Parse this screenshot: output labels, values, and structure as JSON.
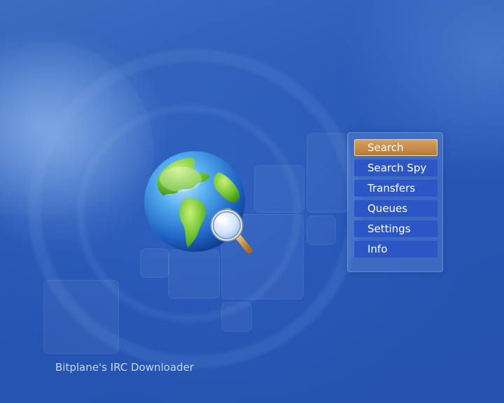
{
  "app": {
    "title": "Bitplane's IRC Downloader"
  },
  "logo": {
    "icon": "globe-magnifier-icon"
  },
  "menu": {
    "selected_index": 0,
    "items": [
      {
        "label": "Search"
      },
      {
        "label": "Search Spy"
      },
      {
        "label": "Transfers"
      },
      {
        "label": "Queues"
      },
      {
        "label": "Settings"
      },
      {
        "label": "Info"
      }
    ]
  },
  "colors": {
    "background": "#3366c4",
    "menu_item": "#2c56c6",
    "menu_selected": "#c98d47",
    "footer_text": "#c9dbf5"
  }
}
